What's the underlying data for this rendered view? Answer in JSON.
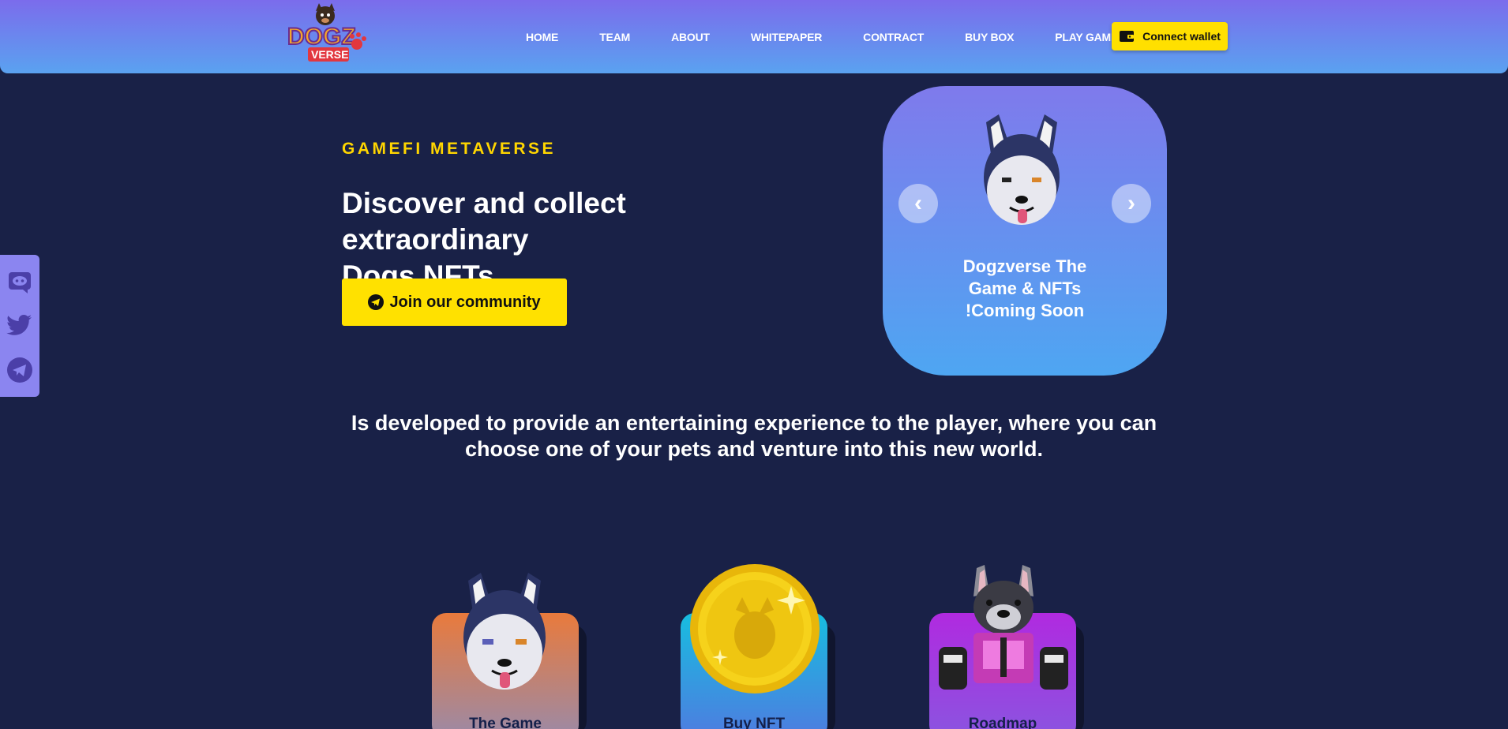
{
  "header": {
    "logo_text_top": "DOGZ",
    "logo_text_bottom": "VERSE",
    "nav": [
      "HOME",
      "TEAM",
      "ABOUT",
      "WHITEPAPER",
      "CONTRACT",
      "BUY BOX",
      "PLAY GAME"
    ],
    "connect_label": "Connect wallet"
  },
  "social": [
    "discord-icon",
    "twitter-icon",
    "telegram-icon"
  ],
  "hero": {
    "eyebrow": "GAMEFI METAVERSE",
    "title_line1": "Discover and collect extraordinary",
    "title_line2": "Dogs NFTs",
    "join_label": "Join our community"
  },
  "carousel": {
    "caption_line1": "Dogzverse The",
    "caption_line2": "Game & NFTs",
    "caption_line3": "!Coming Soon",
    "prev": "‹",
    "next": "›"
  },
  "description": {
    "line1": "Is developed to provide an entertaining experience to the player, where you can",
    "line2": "choose one of your pets and venture into this new world."
  },
  "cards": [
    {
      "label": "The Game",
      "color_top": "#e97a3c",
      "color_bottom": "#9a8aa8"
    },
    {
      "label": "Buy NFT",
      "color_top": "#17bde0",
      "color_bottom": "#4f7be0"
    },
    {
      "label": "Roadmap",
      "color_top": "#b02ae0",
      "color_bottom": "#8a55e0"
    }
  ],
  "colors": {
    "background": "#192147",
    "accent_yellow": "#ffe100",
    "header_top": "#7b6cec",
    "header_bottom": "#5aa2f0"
  }
}
